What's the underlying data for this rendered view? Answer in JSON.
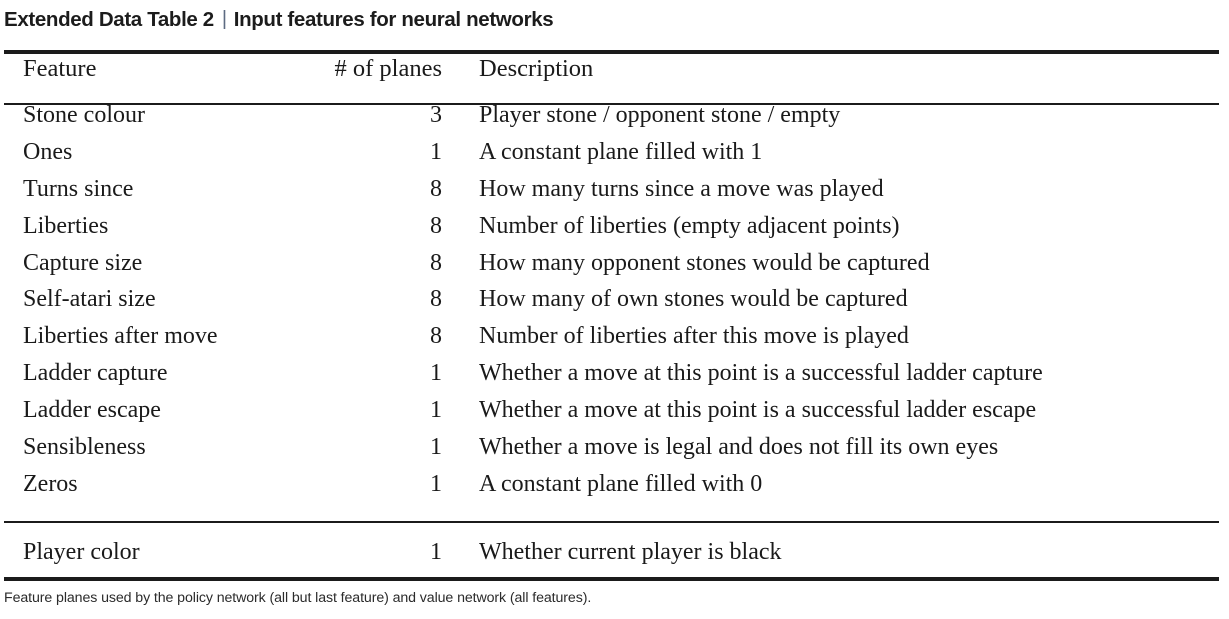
{
  "title": {
    "label": "Extended Data Table 2",
    "separator": "|",
    "subtitle": "Input features for neural networks",
    "separator_color": "#5d6b82"
  },
  "table": {
    "columns": {
      "feature": "Feature",
      "planes": "# of planes",
      "description": "Description"
    },
    "rows": [
      {
        "feature": "Stone colour",
        "planes": "3",
        "description": "Player stone / opponent stone / empty"
      },
      {
        "feature": "Ones",
        "planes": "1",
        "description": "A constant plane filled with 1"
      },
      {
        "feature": "Turns since",
        "planes": "8",
        "description": "How many turns since a move was played"
      },
      {
        "feature": "Liberties",
        "planes": "8",
        "description": "Number of liberties (empty adjacent points)"
      },
      {
        "feature": "Capture size",
        "planes": "8",
        "description": "How many opponent stones would be captured"
      },
      {
        "feature": "Self-atari size",
        "planes": "8",
        "description": "How many of own stones would be captured"
      },
      {
        "feature": "Liberties after move",
        "planes": "8",
        "description": "Number of liberties after this move is played"
      },
      {
        "feature": "Ladder capture",
        "planes": "1",
        "description": "Whether a move at this point is a successful ladder capture"
      },
      {
        "feature": "Ladder escape",
        "planes": "1",
        "description": "Whether a move at this point is a successful ladder escape"
      },
      {
        "feature": "Sensibleness",
        "planes": "1",
        "description": "Whether a move is legal and does not fill its own eyes"
      },
      {
        "feature": "Zeros",
        "planes": "1",
        "description": "A constant plane filled with 0"
      }
    ],
    "last_group_rows": [
      {
        "feature": "Player color",
        "planes": "1",
        "description": "Whether current player is black"
      }
    ]
  },
  "footnote": "Feature planes used by the policy network (all but last feature) and value network (all features)."
}
